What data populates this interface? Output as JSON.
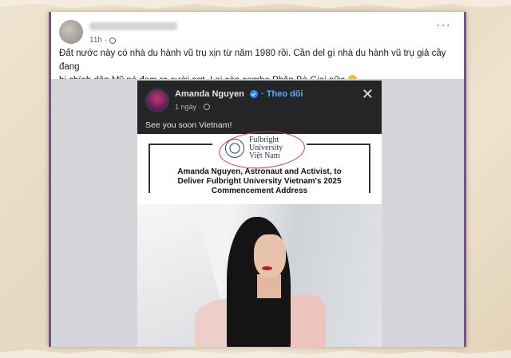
{
  "post": {
    "time": "11h",
    "text_line1": "Đất nước này có nhà du hành vũ trụ xịn từ năm 1980 rồi. Cần del gì nhà du hành vũ trụ giả cầy đang",
    "text_line2": "bị chính dân Mỹ nó đem ra cười cợt. Lại còn combo Phân Bò Giai nữa",
    "more": "···",
    "icons": [
      "globe-icon",
      "more-icon",
      "emoji-icon"
    ]
  },
  "embedded": {
    "author": "Amanda Nguyen",
    "follow": "Theo dõi",
    "time": "1 ngày",
    "caption": "See you soon Vietnam!",
    "close": "✕",
    "logo": {
      "line1": "Fulbright",
      "line2": "University",
      "line3": "Việt Nam"
    },
    "headline_line1": "Amanda Nguyen, Astronaut and Activist, to",
    "headline_line2": "Deliver Fulbright University Vietnam's 2025",
    "headline_line3": "Commencement Address"
  },
  "colors": {
    "frame_border": "#7d4a9e",
    "dark_header": "#242526",
    "follow_link": "#5aa7ff",
    "verified": "#2d88ff",
    "annotation_circle": "#d83a3a"
  }
}
